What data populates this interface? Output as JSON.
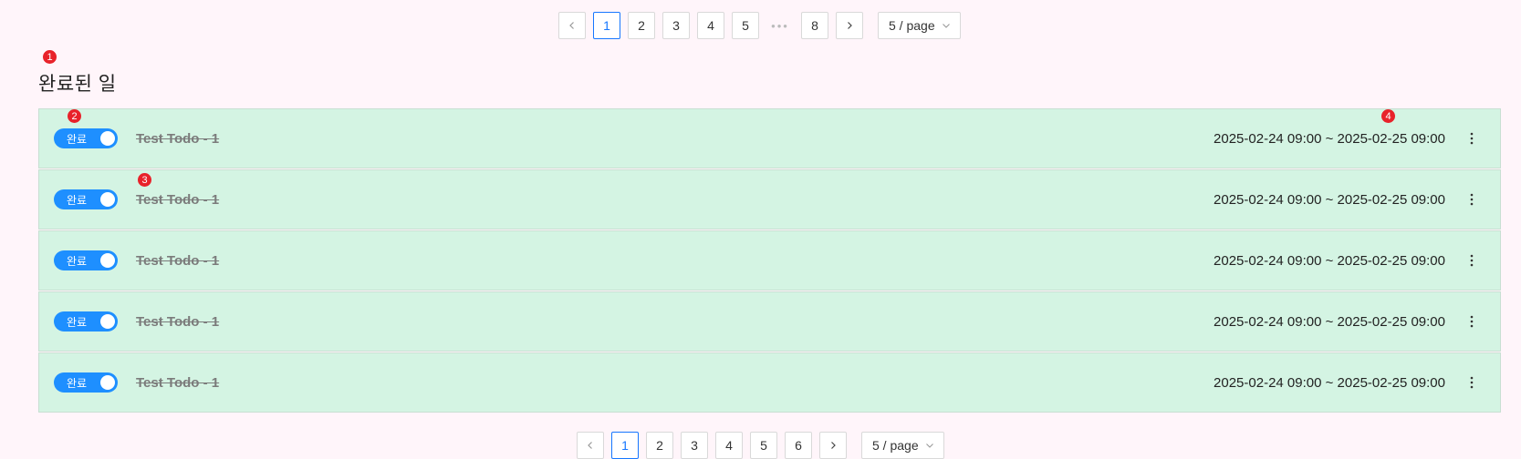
{
  "pagination_top": {
    "pages": [
      "1",
      "2",
      "3",
      "4",
      "5"
    ],
    "ellipsis": "•••",
    "last_page": "8",
    "page_size": "5 / page",
    "active_page": "1"
  },
  "section": {
    "title": "완료된 일"
  },
  "todos": [
    {
      "status_label": "완료",
      "title": "Test Todo - 1",
      "date_range": "2025-02-24 09:00 ~ 2025-02-25 09:00"
    },
    {
      "status_label": "완료",
      "title": "Test Todo - 1",
      "date_range": "2025-02-24 09:00 ~ 2025-02-25 09:00"
    },
    {
      "status_label": "완료",
      "title": "Test Todo - 1",
      "date_range": "2025-02-24 09:00 ~ 2025-02-25 09:00"
    },
    {
      "status_label": "완료",
      "title": "Test Todo - 1",
      "date_range": "2025-02-24 09:00 ~ 2025-02-25 09:00"
    },
    {
      "status_label": "완료",
      "title": "Test Todo - 1",
      "date_range": "2025-02-24 09:00 ~ 2025-02-25 09:00"
    }
  ],
  "pagination_bottom": {
    "pages": [
      "1",
      "2",
      "3",
      "4",
      "5",
      "6"
    ],
    "page_size": "5 / page",
    "active_page": "1"
  },
  "markers": [
    "1",
    "2",
    "3",
    "4"
  ],
  "colors": {
    "background": "#fff5fa",
    "row_background": "#d4f4e3",
    "toggle_on": "#1e8fff",
    "active_page": "#1677ff",
    "marker": "#e8222a"
  },
  "icons": [
    "chevron-left-icon",
    "chevron-right-icon",
    "chevron-down-icon",
    "more-vertical-icon"
  ]
}
